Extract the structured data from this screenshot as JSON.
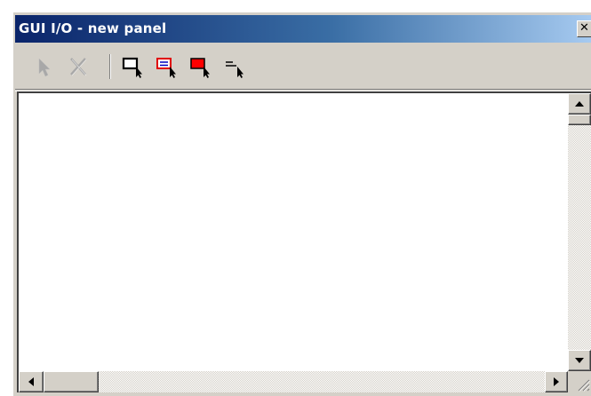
{
  "window": {
    "title": "GUI I/O - new panel",
    "close_glyph": "✕"
  },
  "toolbar": {
    "buttons": [
      {
        "name": "select-pointer-icon",
        "enabled": false
      },
      {
        "name": "delete-icon",
        "enabled": false
      },
      {
        "name": "add-frame-icon",
        "enabled": true
      },
      {
        "name": "add-textbox-icon",
        "enabled": true
      },
      {
        "name": "add-filled-box-icon",
        "enabled": true
      },
      {
        "name": "add-label-icon",
        "enabled": true
      }
    ]
  },
  "colors": {
    "title_start": "#0a246a",
    "title_end": "#a6caf0",
    "face": "#d4d0c8",
    "icon_red": "#ff0000",
    "icon_blue": "#0000c0"
  }
}
